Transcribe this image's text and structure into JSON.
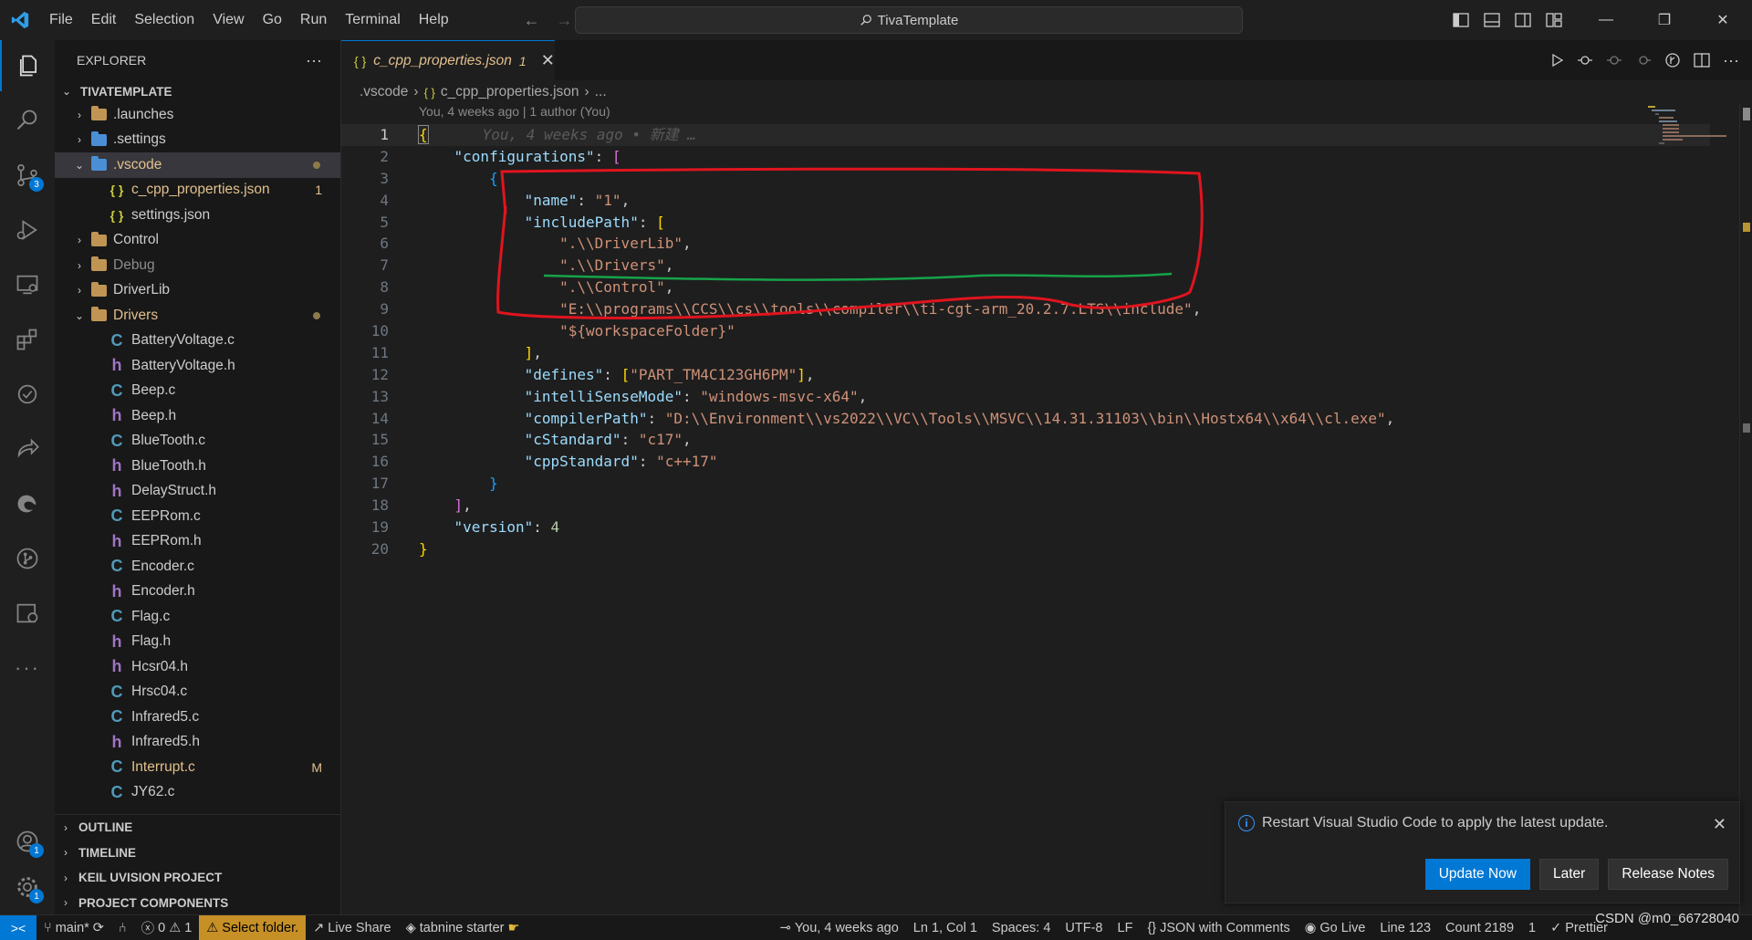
{
  "titlebar": {
    "menu": [
      "File",
      "Edit",
      "Selection",
      "View",
      "Go",
      "Run",
      "Terminal",
      "Help"
    ],
    "search_text": "TivaTemplate"
  },
  "sidebar": {
    "title": "EXPLORER",
    "more": "···",
    "project": "TIVATEMPLATE",
    "tree": [
      {
        "label": ".launches",
        "kind": "folder",
        "depth": 0,
        "expanded": false
      },
      {
        "label": ".settings",
        "kind": "folder-blue",
        "depth": 0,
        "expanded": false
      },
      {
        "label": ".vscode",
        "kind": "folder-blue",
        "depth": 0,
        "expanded": true,
        "selected": true,
        "color": "#e2c08d",
        "dot": true
      },
      {
        "label": "c_cpp_properties.json",
        "kind": "json",
        "depth": 1,
        "color": "#e2c08d",
        "badge": "1"
      },
      {
        "label": "settings.json",
        "kind": "json",
        "depth": 1
      },
      {
        "label": "Control",
        "kind": "folder",
        "depth": 0,
        "expanded": false
      },
      {
        "label": "Debug",
        "kind": "folder",
        "depth": 0,
        "expanded": false,
        "color": "#8c8c8c"
      },
      {
        "label": "DriverLib",
        "kind": "folder",
        "depth": 0,
        "expanded": false
      },
      {
        "label": "Drivers",
        "kind": "folder",
        "depth": 0,
        "expanded": true,
        "color": "#e2c08d",
        "dot": true
      },
      {
        "label": "BatteryVoltage.c",
        "kind": "c",
        "depth": 1
      },
      {
        "label": "BatteryVoltage.h",
        "kind": "h",
        "depth": 1
      },
      {
        "label": "Beep.c",
        "kind": "c",
        "depth": 1
      },
      {
        "label": "Beep.h",
        "kind": "h",
        "depth": 1
      },
      {
        "label": "BlueTooth.c",
        "kind": "c",
        "depth": 1
      },
      {
        "label": "BlueTooth.h",
        "kind": "h",
        "depth": 1
      },
      {
        "label": "DelayStruct.h",
        "kind": "h",
        "depth": 1
      },
      {
        "label": "EEPRom.c",
        "kind": "c",
        "depth": 1
      },
      {
        "label": "EEPRom.h",
        "kind": "h",
        "depth": 1
      },
      {
        "label": "Encoder.c",
        "kind": "c",
        "depth": 1
      },
      {
        "label": "Encoder.h",
        "kind": "h",
        "depth": 1
      },
      {
        "label": "Flag.c",
        "kind": "c",
        "depth": 1
      },
      {
        "label": "Flag.h",
        "kind": "h",
        "depth": 1
      },
      {
        "label": "Hcsr04.h",
        "kind": "h",
        "depth": 1
      },
      {
        "label": "Hrsc04.c",
        "kind": "c",
        "depth": 1
      },
      {
        "label": "Infrared5.c",
        "kind": "c",
        "depth": 1
      },
      {
        "label": "Infrared5.h",
        "kind": "h",
        "depth": 1
      },
      {
        "label": "Interrupt.c",
        "kind": "c",
        "depth": 1,
        "color": "#e2c08d",
        "badge": "M"
      },
      {
        "label": "JY62.c",
        "kind": "c",
        "depth": 1
      }
    ],
    "sections": [
      "OUTLINE",
      "TIMELINE",
      "KEIL UVISION PROJECT",
      "PROJECT COMPONENTS"
    ]
  },
  "activity": {
    "scm_badge": "3",
    "accounts_badge": "1",
    "manage_badge": "1"
  },
  "editor": {
    "tab_label": "c_cpp_properties.json",
    "tab_problems": "1",
    "breadcrumb": [
      ".vscode",
      "c_cpp_properties.json",
      "..."
    ],
    "blame_header": "You, 4 weeks ago | 1 author (You)",
    "ghost_text": "You, 4 weeks ago • 新建 …",
    "lines": [
      [
        [
          "b1",
          "{"
        ]
      ],
      [
        [
          "p",
          "    "
        ],
        [
          "k",
          "\"configurations\""
        ],
        [
          "p",
          ": "
        ],
        [
          "b2",
          "["
        ]
      ],
      [
        [
          "p",
          "        "
        ],
        [
          "b3",
          "{"
        ]
      ],
      [
        [
          "p",
          "            "
        ],
        [
          "k",
          "\"name\""
        ],
        [
          "p",
          ": "
        ],
        [
          "s",
          "\"1\""
        ],
        [
          "p",
          ","
        ]
      ],
      [
        [
          "p",
          "            "
        ],
        [
          "k",
          "\"includePath\""
        ],
        [
          "p",
          ": "
        ],
        [
          "b1",
          "["
        ]
      ],
      [
        [
          "p",
          "                "
        ],
        [
          "s",
          "\".\\\\DriverLib\""
        ],
        [
          "p",
          ","
        ]
      ],
      [
        [
          "p",
          "                "
        ],
        [
          "s",
          "\".\\\\Drivers\""
        ],
        [
          "p",
          ","
        ]
      ],
      [
        [
          "p",
          "                "
        ],
        [
          "s",
          "\".\\\\Control\""
        ],
        [
          "p",
          ","
        ]
      ],
      [
        [
          "p",
          "                "
        ],
        [
          "s",
          "\"E:\\\\programs\\\\CCS\\\\cs\\\\tools\\\\compiler\\\\ti-cgt-arm_20.2.7.LTS\\\\include\""
        ],
        [
          "p",
          ","
        ]
      ],
      [
        [
          "p",
          "                "
        ],
        [
          "s",
          "\"${workspaceFolder}\""
        ]
      ],
      [
        [
          "p",
          "            "
        ],
        [
          "b1",
          "]"
        ],
        [
          "p",
          ","
        ]
      ],
      [
        [
          "p",
          "            "
        ],
        [
          "k",
          "\"defines\""
        ],
        [
          "p",
          ": "
        ],
        [
          "b1",
          "["
        ],
        [
          "s",
          "\"PART_TM4C123GH6PM\""
        ],
        [
          "b1",
          "]"
        ],
        [
          "p",
          ","
        ]
      ],
      [
        [
          "p",
          "            "
        ],
        [
          "k",
          "\"intelliSenseMode\""
        ],
        [
          "p",
          ": "
        ],
        [
          "s",
          "\"windows-msvc-x64\""
        ],
        [
          "p",
          ","
        ]
      ],
      [
        [
          "p",
          "            "
        ],
        [
          "k",
          "\"compilerPath\""
        ],
        [
          "p",
          ": "
        ],
        [
          "s",
          "\"D:\\\\Environment\\\\vs2022\\\\VC\\\\Tools\\\\MSVC\\\\14.31.31103\\\\bin\\\\Hostx64\\\\x64\\\\cl.exe\""
        ],
        [
          "p",
          ","
        ]
      ],
      [
        [
          "p",
          "            "
        ],
        [
          "k",
          "\"cStandard\""
        ],
        [
          "p",
          ": "
        ],
        [
          "s",
          "\"c17\""
        ],
        [
          "p",
          ","
        ]
      ],
      [
        [
          "p",
          "            "
        ],
        [
          "k",
          "\"cppStandard\""
        ],
        [
          "p",
          ": "
        ],
        [
          "s",
          "\"c++17\""
        ]
      ],
      [
        [
          "p",
          "        "
        ],
        [
          "b3",
          "}"
        ]
      ],
      [
        [
          "p",
          "    "
        ],
        [
          "b2",
          "]"
        ],
        [
          "p",
          ","
        ]
      ],
      [
        [
          "p",
          "    "
        ],
        [
          "k",
          "\"version\""
        ],
        [
          "p",
          ": "
        ],
        [
          "n",
          "4"
        ]
      ],
      [
        [
          "b1",
          "}"
        ]
      ]
    ]
  },
  "notification": {
    "message": "Restart Visual Studio Code to apply the latest update.",
    "buttons": [
      "Update Now",
      "Later",
      "Release Notes"
    ]
  },
  "statusbar": {
    "remote": "><",
    "branch": "main*",
    "errors": "0",
    "warnings": "1",
    "select_folder": "Select folder.",
    "live_share": "Live Share",
    "tabnine": "tabnine starter",
    "blame": "You, 4 weeks ago",
    "position": "Ln 1, Col 1",
    "spaces": "Spaces: 4",
    "encoding": "UTF-8",
    "eol": "LF",
    "language": "JSON with Comments",
    "go_live": "Go Live",
    "line_count": "Line 123",
    "count": "Count 2189",
    "one": "1",
    "prettier": "Prettier",
    "watermark": "CSDN @m0_66728040"
  },
  "colors": {
    "accent": "#0078d4",
    "annotation_red": "#e0141e",
    "annotation_green": "#16a34a",
    "warning": "#c69026"
  }
}
